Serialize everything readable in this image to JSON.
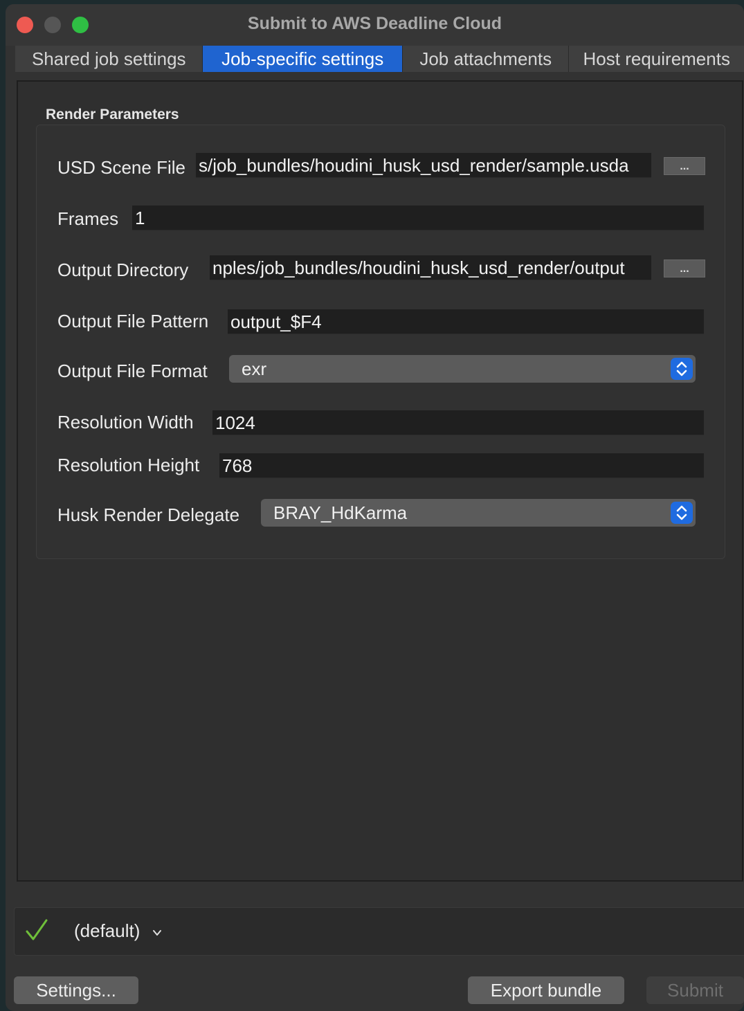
{
  "window": {
    "title": "Submit to AWS Deadline Cloud"
  },
  "tabs": [
    {
      "label": "Shared job settings",
      "active": false
    },
    {
      "label": "Job-specific settings",
      "active": true
    },
    {
      "label": "Job attachments",
      "active": false
    },
    {
      "label": "Host requirements",
      "active": false
    }
  ],
  "render_parameters": {
    "group_title": "Render Parameters",
    "usd_scene_file": {
      "label": "USD Scene File",
      "value": "s/job_bundles/houdini_husk_usd_render/sample.usda",
      "browse_label": "..."
    },
    "frames": {
      "label": "Frames",
      "value": "1"
    },
    "output_directory": {
      "label": "Output Directory",
      "value": "nples/job_bundles/houdini_husk_usd_render/output",
      "browse_label": "..."
    },
    "output_file_pattern": {
      "label": "Output File Pattern",
      "value": "output_$F4"
    },
    "output_file_format": {
      "label": "Output File Format",
      "value": "exr"
    },
    "resolution_width": {
      "label": "Resolution Width",
      "value": "1024"
    },
    "resolution_height": {
      "label": "Resolution Height",
      "value": "768"
    },
    "husk_render_delegate": {
      "label": "Husk Render Delegate",
      "value": "BRAY_HdKarma"
    }
  },
  "profile": {
    "label": "(default)",
    "status_icon": "checkmark-icon"
  },
  "buttons": {
    "settings": "Settings...",
    "export_bundle": "Export bundle",
    "submit": "Submit"
  },
  "colors": {
    "accent": "#1f64d0",
    "check": "#6fbf3a"
  }
}
